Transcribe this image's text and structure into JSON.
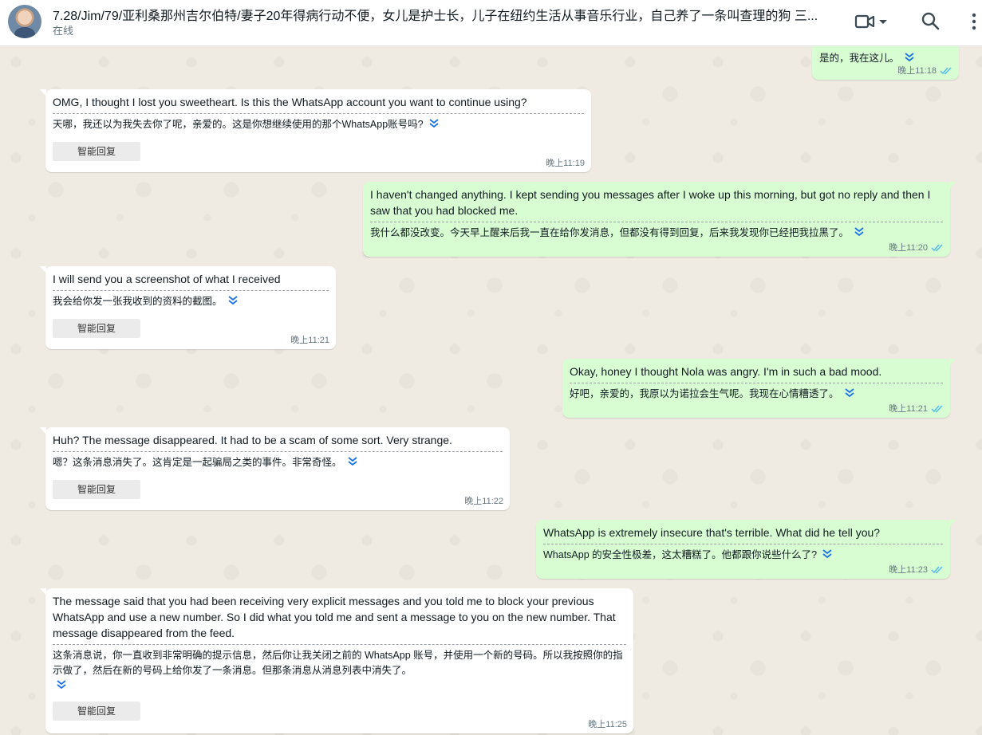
{
  "header": {
    "contact_name": "7.28/Jim/79/亚利桑那州吉尔伯特/妻子20年得病行动不便，女儿是护士长，儿子在纽约生活从事音乐行业，自己养了一条叫查理的狗  三...",
    "status": "在线",
    "icons": [
      "avatar",
      "video-call-icon",
      "chevron-down-icon",
      "search-icon",
      "more-vert-icon"
    ]
  },
  "colors": {
    "incoming_bubble": "#ffffff",
    "outgoing_bubble": "#d9fdd3",
    "chat_background": "#efeae2",
    "read_tick": "#53bdeb",
    "translate_chevron": "#1a73e8"
  },
  "smart_reply_label": "智能回复",
  "messages": [
    {
      "direction": "out",
      "text": "",
      "translation": "是的，我在这儿。",
      "time": "晚上11:18",
      "smart_reply": false
    },
    {
      "direction": "in",
      "text": "OMG, I thought I lost you sweetheart.  Is this the WhatsApp account you want to continue using?",
      "translation": "天哪，我还以为我失去你了呢，亲爱的。这是你想继续使用的那个WhatsApp账号吗?",
      "time": "晚上11:19",
      "smart_reply": true
    },
    {
      "direction": "out",
      "text": "I haven't changed anything. I kept sending you messages after I woke up this morning, but got no reply and then I saw that you had blocked me.",
      "translation": "我什么都没改变。今天早上醒来后我一直在给你发消息，但都没有得到回复，后来我发现你已经把我拉黑了。",
      "time": "晚上11:20",
      "smart_reply": false
    },
    {
      "direction": "in",
      "text": "I will send you a screenshot of what I received",
      "translation": "我会给你发一张我收到的资料的截图。",
      "time": "晚上11:21",
      "smart_reply": true
    },
    {
      "direction": "out",
      "text": "Okay, honey I thought Nola was angry. I'm in such a bad mood.",
      "translation": "好吧，亲爱的，我原以为诺拉会生气呢。我现在心情糟透了。",
      "time": "晚上11:21",
      "smart_reply": false
    },
    {
      "direction": "in",
      "text": "Huh? The message disappeared. It had to be a scam of some sort. Very strange.",
      "translation": "嗯？这条消息消失了。这肯定是一起骗局之类的事件。非常奇怪。",
      "time": "晚上11:22",
      "smart_reply": true
    },
    {
      "direction": "out",
      "text": "WhatsApp is extremely insecure that's terrible. What did he tell you?",
      "translation": "WhatsApp 的安全性极差，这太糟糕了。他都跟你说些什么了?",
      "time": "晚上11:23",
      "smart_reply": false
    },
    {
      "direction": "in",
      "text": "The message said that you had been receiving very explicit messages and you told me to block your previous WhatsApp and use a new number. So I did what you told me and sent a message to you on the new number. That message disappeared from the feed.",
      "translation": "这条消息说，你一直收到非常明确的提示信息，然后你让我关闭之前的 WhatsApp 账号，并使用一个新的号码。所以我按照你的指示做了，然后在新的号码上给你发了一条消息。但那条消息从消息列表中消失了。",
      "time": "晚上11:25",
      "smart_reply": true
    }
  ]
}
